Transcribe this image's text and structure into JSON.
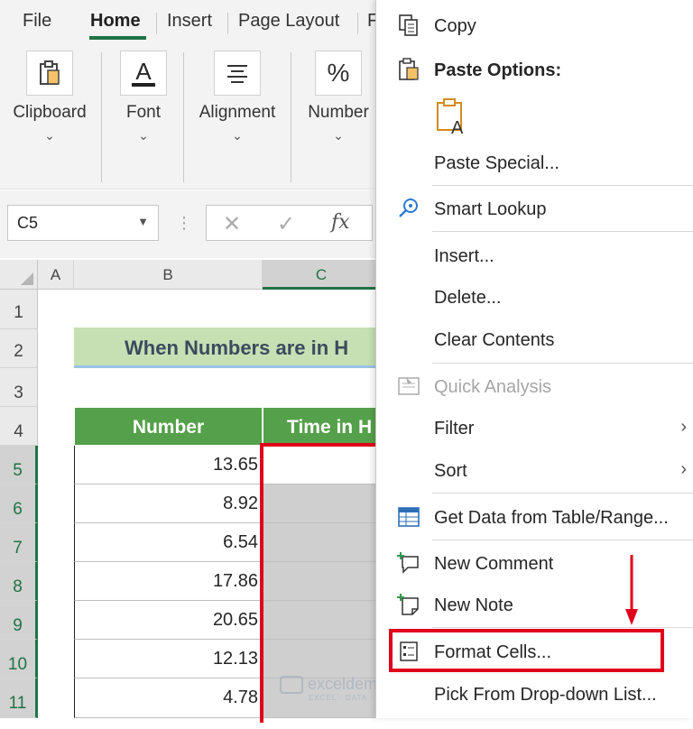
{
  "ribbon": {
    "tabs": [
      "File",
      "Home",
      "Insert",
      "Page Layout",
      "F"
    ],
    "active_tab": "Home",
    "groups": [
      "Clipboard",
      "Font",
      "Alignment",
      "Number"
    ],
    "font_icon_glyph": "A",
    "number_icon_glyph": "%"
  },
  "formula_bar": {
    "name_box": "C5",
    "cancel_glyph": "✕",
    "enter_glyph": "✓",
    "fx_glyph": "fx"
  },
  "sheet": {
    "columns": [
      "A",
      "B",
      "C"
    ],
    "rows": [
      "1",
      "2",
      "3",
      "4",
      "5",
      "6",
      "7",
      "8",
      "9",
      "10",
      "11"
    ],
    "title": "When Numbers are in H",
    "headers": [
      "Number",
      "Time in H"
    ],
    "numbers": [
      "13.65",
      "8.92",
      "6.54",
      "17.86",
      "20.65",
      "12.13",
      "4.78"
    ],
    "selected_cell": "C5"
  },
  "context_menu": {
    "items": [
      {
        "label": "Copy",
        "icon": "copy-icon"
      },
      {
        "label": "Paste Options:",
        "icon": "paste-icon"
      },
      {
        "label": "Paste Special...",
        "icon": ""
      },
      {
        "label": "Smart Lookup",
        "icon": "search-icon"
      },
      {
        "label": "Insert...",
        "icon": ""
      },
      {
        "label": "Delete...",
        "icon": ""
      },
      {
        "label": "Clear Contents",
        "icon": ""
      },
      {
        "label": "Quick Analysis",
        "icon": "quick-analysis-icon",
        "disabled": true
      },
      {
        "label": "Filter",
        "icon": "",
        "submenu": true
      },
      {
        "label": "Sort",
        "icon": "",
        "submenu": true
      },
      {
        "label": "Get Data from Table/Range...",
        "icon": "table-icon"
      },
      {
        "label": "New Comment",
        "icon": "new-comment-icon"
      },
      {
        "label": "New Note",
        "icon": "new-note-icon"
      },
      {
        "label": "Format Cells...",
        "icon": "format-cells-icon"
      },
      {
        "label": "Pick From Drop-down List...",
        "icon": ""
      }
    ],
    "submenu_arrow": "›"
  },
  "watermark": {
    "brand": "exceldemy",
    "tagline": "EXCEL · DATA · BI"
  },
  "colors": {
    "accent": "#217346",
    "header_green": "#55a04a",
    "title_fill": "#c6e0b4",
    "highlight_red": "#e0001b"
  }
}
